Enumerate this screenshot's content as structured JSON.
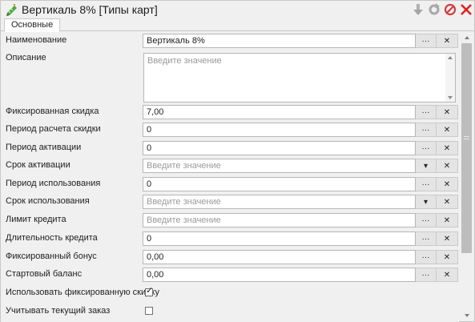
{
  "window": {
    "title": "Вертикаль 8% [Типы карт]",
    "icons": {
      "app": "green-ruler-pencil-icon",
      "download": "download-arrow-icon",
      "refresh": "refresh-icon",
      "stop": "stop-icon",
      "close": "close-icon"
    }
  },
  "tabs": [
    {
      "label": "Основные",
      "active": true
    }
  ],
  "buttons": {
    "dots_label": "···",
    "clear_label": "✕",
    "dropdown_label": "▾"
  },
  "fields": {
    "name": {
      "label": "Наименование",
      "value": "Вертикаль 8%",
      "placeholder": ""
    },
    "description": {
      "label": "Описание",
      "value": "",
      "placeholder": "Введите значение"
    },
    "fixed_discount": {
      "label": "Фиксированная скидка",
      "value": "7,00",
      "placeholder": ""
    },
    "discount_calc_period": {
      "label": "Период расчета скидки",
      "value": "0",
      "placeholder": ""
    },
    "activation_period": {
      "label": "Период активации",
      "value": "0",
      "placeholder": ""
    },
    "activation_term": {
      "label": "Срок активации",
      "value": "",
      "placeholder": "Введите значение"
    },
    "usage_period": {
      "label": "Период использования",
      "value": "0",
      "placeholder": ""
    },
    "usage_term": {
      "label": "Срок использования",
      "value": "",
      "placeholder": "Введите значение"
    },
    "credit_limit": {
      "label": "Лимит кредита",
      "value": "",
      "placeholder": "Введите значение"
    },
    "credit_duration": {
      "label": "Длительность кредита",
      "value": "0",
      "placeholder": ""
    },
    "fixed_bonus": {
      "label": "Фиксированный бонус",
      "value": "0,00",
      "placeholder": ""
    },
    "start_balance": {
      "label": "Стартовый баланс",
      "value": "0,00",
      "placeholder": ""
    },
    "use_fixed_discount": {
      "label": "Использовать фиксированную скидку",
      "checked": true,
      "mark": "✓"
    },
    "consider_current_order": {
      "label": "Учитывать текущий заказ",
      "checked": false
    }
  },
  "colors": {
    "clear_x": "#1e1e1e",
    "stop_red": "#d63a3a",
    "close_red": "#e02020",
    "app_green": "#3a9a2a"
  }
}
